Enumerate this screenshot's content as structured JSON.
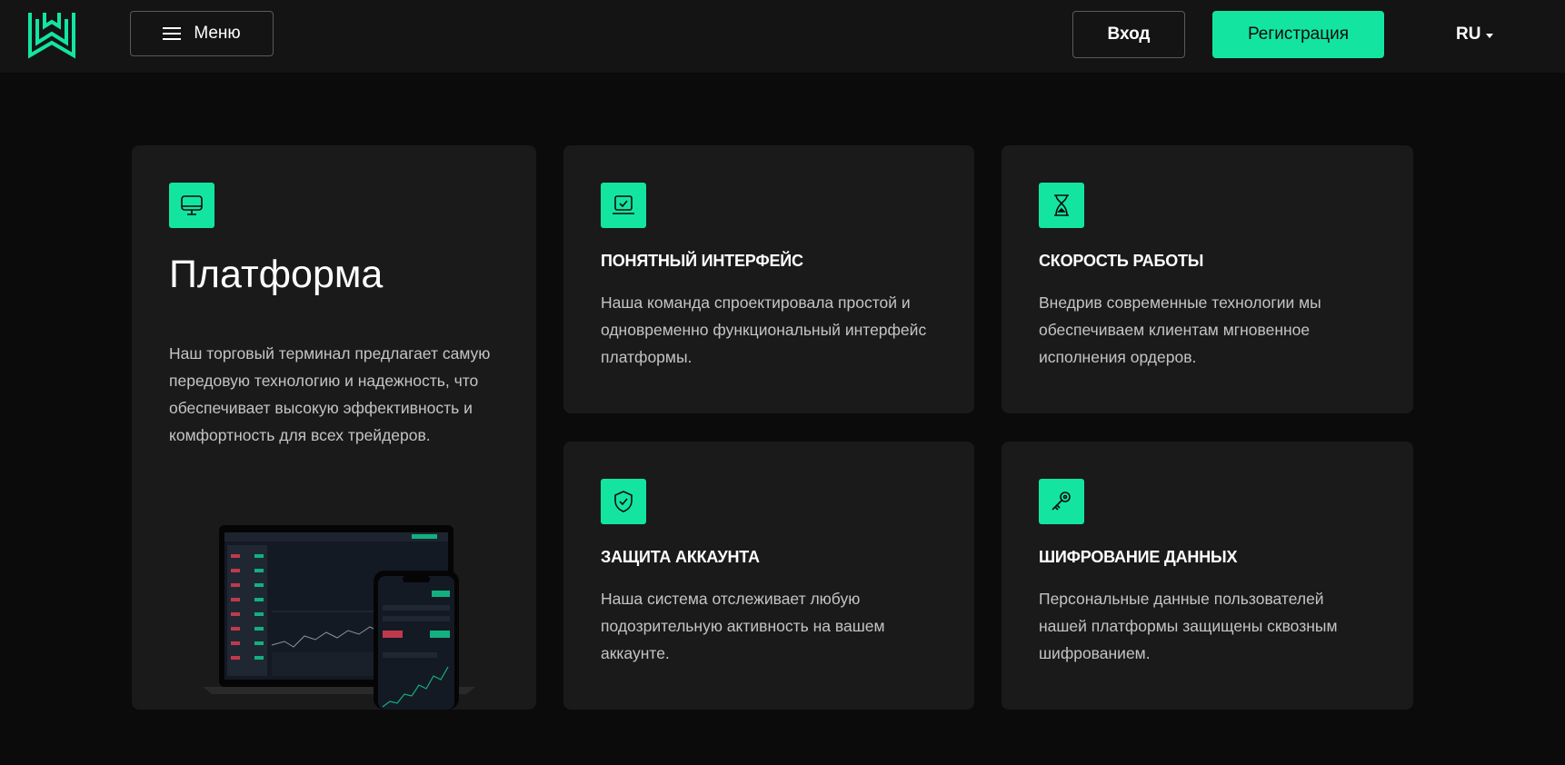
{
  "header": {
    "menu_label": "Меню",
    "login_label": "Вход",
    "register_label": "Регистрация",
    "language": "RU"
  },
  "colors": {
    "accent": "#13e5a1",
    "background": "#0b0b0b",
    "header_bg": "#141414",
    "card_bg": "#1a1a1a",
    "text_muted": "#c4c4c4"
  },
  "platform": {
    "icon": "monitor-icon",
    "title": "Платформа",
    "description": "Наш торговый терминал предлагает самую передовую технологию и надежность, что обеспечивает высокую эффективность и комфортность для всех трейдеров."
  },
  "features": [
    {
      "icon": "laptop-check-icon",
      "title": "ПОНЯТНЫЙ ИНТЕРФЕЙС",
      "description": "Наша команда спроектировала простой и одновременно функциональный интерфейс платформы."
    },
    {
      "icon": "hourglass-icon",
      "title": "СКОРОСТЬ РАБОТЫ",
      "description": "Внедрив современные технологии мы обеспечиваем клиентам мгновенное исполнения ордеров."
    },
    {
      "icon": "shield-check-icon",
      "title": "ЗАЩИТА АККАУНТА",
      "description": "Наша система отслеживает любую подозрительную активность на вашем аккаунте."
    },
    {
      "icon": "key-icon",
      "title": "ШИФРОВАНИЕ ДАННЫХ",
      "description": "Персональные данные пользователей нашей платформы защищены сквозным шифрованием."
    }
  ]
}
